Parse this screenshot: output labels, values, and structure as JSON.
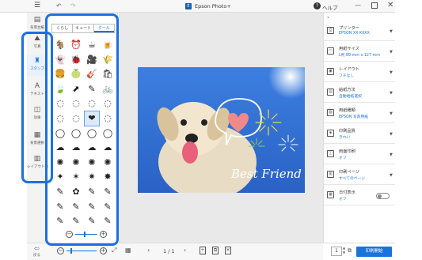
{
  "app": {
    "title": "Epson Photo+",
    "icon_name": "epson-app-icon"
  },
  "topbar": {
    "menu_icon": "hamburger-icon",
    "undo_icon": "undo-icon",
    "redo_icon": "redo-icon",
    "help_label": "ヘルプ"
  },
  "left_rail": {
    "items": [
      {
        "icon": "template-icon",
        "glyph": "▤",
        "label": "背景台紙"
      },
      {
        "icon": "photo-icon",
        "glyph": "⛰",
        "label": "写真"
      },
      {
        "icon": "stamp-icon",
        "glyph": "♜",
        "label": "スタンプ"
      },
      {
        "icon": "text-icon",
        "glyph": "A",
        "label": "テキスト"
      },
      {
        "icon": "frame-icon",
        "glyph": "◫",
        "label": "効果"
      },
      {
        "icon": "background-icon",
        "glyph": "▦",
        "label": "背景選択"
      },
      {
        "icon": "layout-icon",
        "glyph": "▥",
        "label": "レイアウト設定"
      }
    ],
    "active_index": 2
  },
  "stamp_panel": {
    "tabs": [
      "くらし",
      "キュート",
      "クール"
    ],
    "selected_tab": 2,
    "stamps": [
      "🐐",
      "⏰",
      "☕",
      "🍺",
      "👻",
      "🐞",
      "🎥",
      "🌾",
      "🍔",
      "🍈",
      "🎸",
      "🛍",
      "🍃",
      "⬈",
      "✎",
      "🚲",
      "◌",
      "◌",
      "◌",
      "◌",
      "◌",
      "◌",
      "❤",
      "◌",
      "◯",
      "◯",
      "◯",
      "◯",
      "☁",
      "☁",
      "☁",
      "☁",
      "✺",
      "✺",
      "✺",
      "✺",
      "✦",
      "✶",
      "✷",
      "✸",
      "✎",
      "✿",
      "✎",
      "✎",
      "✎",
      "✎",
      "✎",
      "✎",
      "✎",
      "✎",
      "✎",
      "✎"
    ],
    "selected_stamp_index": 22,
    "zoom_out_icon": "zoom-out-icon",
    "zoom_in_icon": "zoom-in-icon"
  },
  "canvas": {
    "photo_description_text": "Best Friend",
    "sky_color": "#2f6fd0",
    "heart_color": "#f08a8a",
    "firework_colors": [
      "#f2d640",
      "#ffffff",
      "#8fd24a"
    ]
  },
  "bottombar": {
    "back_label": "戻る",
    "page_indicator": "1 / 1"
  },
  "right_panel": {
    "settings": [
      {
        "icon": "printer-icon",
        "glyph": "⎙",
        "name": "プリンター",
        "value": "EPSON XX-XXXX",
        "type": "select"
      },
      {
        "icon": "paper-size-icon",
        "glyph": "▭",
        "name": "用紙サイズ",
        "value": "L判 89 mm x 127 mm",
        "type": "select"
      },
      {
        "icon": "layout-icon",
        "glyph": "▣",
        "name": "レイアウト",
        "value": "フチなし",
        "type": "select"
      },
      {
        "icon": "paper-feed-icon",
        "glyph": "▤",
        "name": "給紙方法",
        "value": "自動給紙選択",
        "type": "select"
      },
      {
        "icon": "paper-type-icon",
        "glyph": "▧",
        "name": "用紙種類",
        "value": "EPSON 写真用紙",
        "type": "select"
      },
      {
        "icon": "quality-icon",
        "glyph": "◈",
        "name": "印刷品質",
        "value": "きれい",
        "type": "select"
      },
      {
        "icon": "duplex-icon",
        "glyph": "◫",
        "name": "両面印刷",
        "value": "オフ",
        "type": "select"
      },
      {
        "icon": "page-range-icon",
        "glyph": "▥",
        "name": "印刷ページ",
        "value": "すべてのページ",
        "type": "select"
      },
      {
        "icon": "date-icon",
        "glyph": "▦",
        "name": "日付表示",
        "value": "オフ",
        "type": "toggle"
      }
    ],
    "copies": "1",
    "print_button": "印刷開始"
  },
  "colors": {
    "accent": "#1a73d9",
    "highlight_outline": "#1d6fe0"
  }
}
